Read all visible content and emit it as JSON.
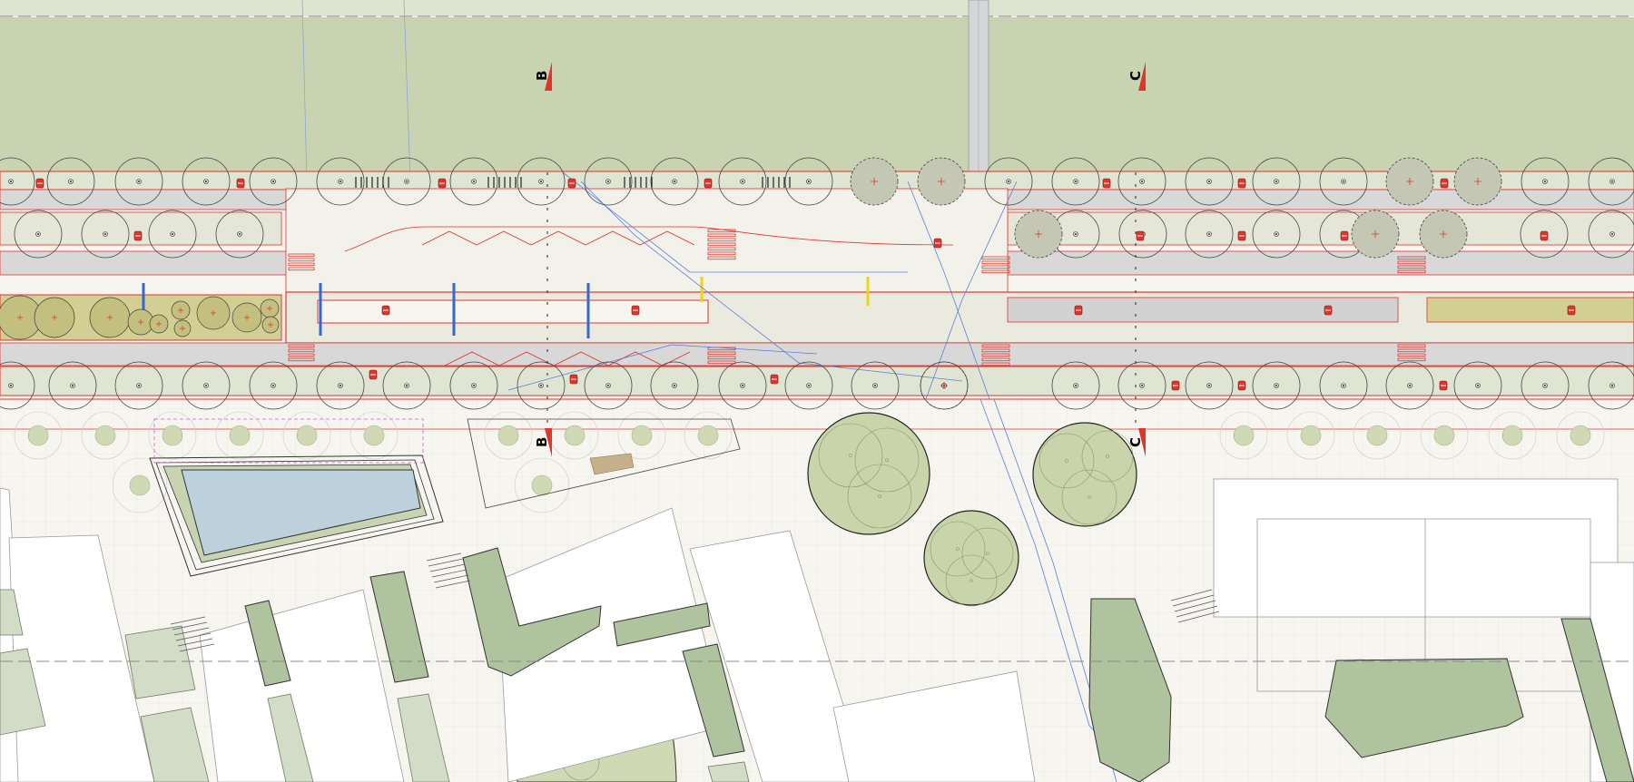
{
  "section_markers": {
    "b_label": "B",
    "c_label": "C"
  },
  "colors": {
    "background": "#f6f5ef",
    "lawn": "#c8d3b1",
    "lawn_light": "#dfe4d0",
    "tree_canopy": "#cfd9b3",
    "building_roof": "#afc39e",
    "water": "#bdd1dc",
    "plaza": "#f1f0e7",
    "road_grey": "#d9d9d9",
    "planting_strip": "#d3cf92",
    "red_line": "#e0342c",
    "blue_line": "#3367d6",
    "yellow_mark": "#f2d21b",
    "magenta_dash": "#d85bd3"
  },
  "icons": {
    "section_marker": "section-flag-icon",
    "tree": "tree-symbol-icon",
    "bench": "bench-icon",
    "bin": "waste-bin-icon",
    "bike_rack": "bike-rack-icon"
  }
}
